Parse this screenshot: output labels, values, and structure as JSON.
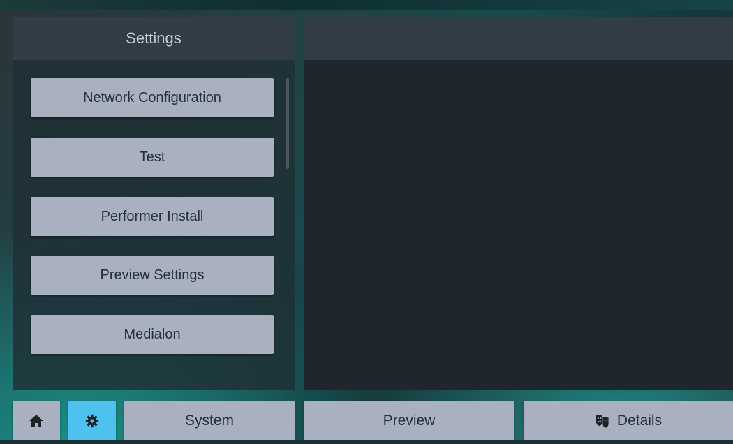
{
  "left_panel": {
    "title": "Settings",
    "items": [
      {
        "label": "Network Configuration"
      },
      {
        "label": "Test"
      },
      {
        "label": "Performer Install"
      },
      {
        "label": "Preview Settings"
      },
      {
        "label": "Medialon"
      }
    ]
  },
  "bottom_bar": {
    "home_icon": "home-icon",
    "settings_icon": "gear-icon",
    "system_label": "System",
    "preview_label": "Preview",
    "details_label": "Details",
    "details_icon": "theater-masks-icon"
  },
  "colors": {
    "button_bg": "#a9b1c0",
    "active_bg": "#4fc1ee",
    "header_bg": "#323c45",
    "panel_bg": "#1f262d"
  }
}
